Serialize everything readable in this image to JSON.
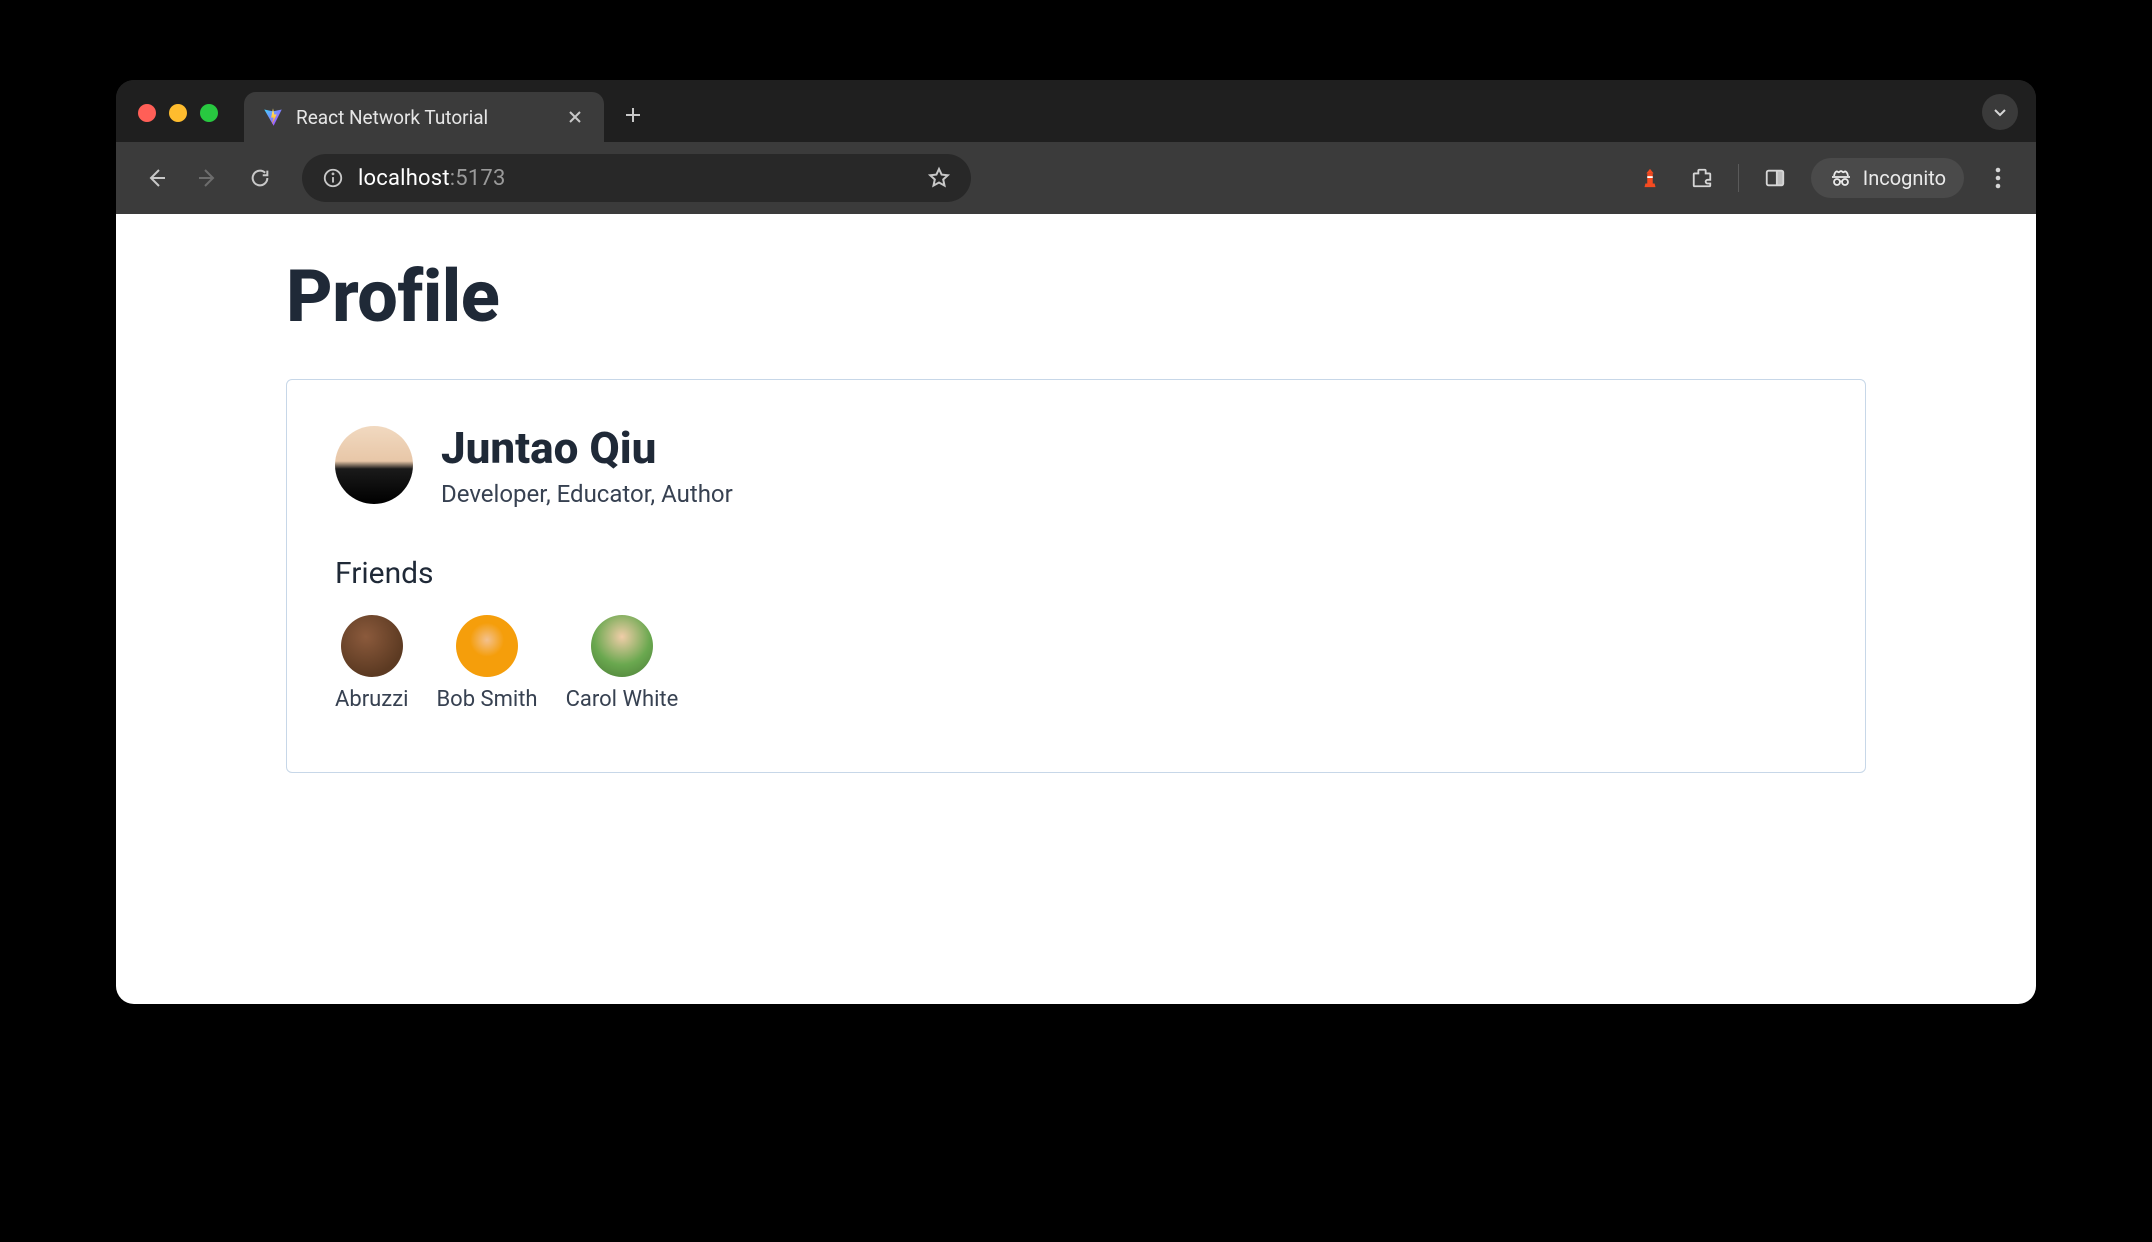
{
  "browser": {
    "tab_title": "React Network Tutorial",
    "url_host": "localhost",
    "url_port": ":5173",
    "incognito_label": "Incognito"
  },
  "page": {
    "title": "Profile",
    "profile": {
      "name": "Juntao Qiu",
      "bio": "Developer, Educator, Author"
    },
    "friends_heading": "Friends",
    "friends": [
      {
        "name": "Abruzzi"
      },
      {
        "name": "Bob Smith"
      },
      {
        "name": "Carol White"
      }
    ]
  }
}
